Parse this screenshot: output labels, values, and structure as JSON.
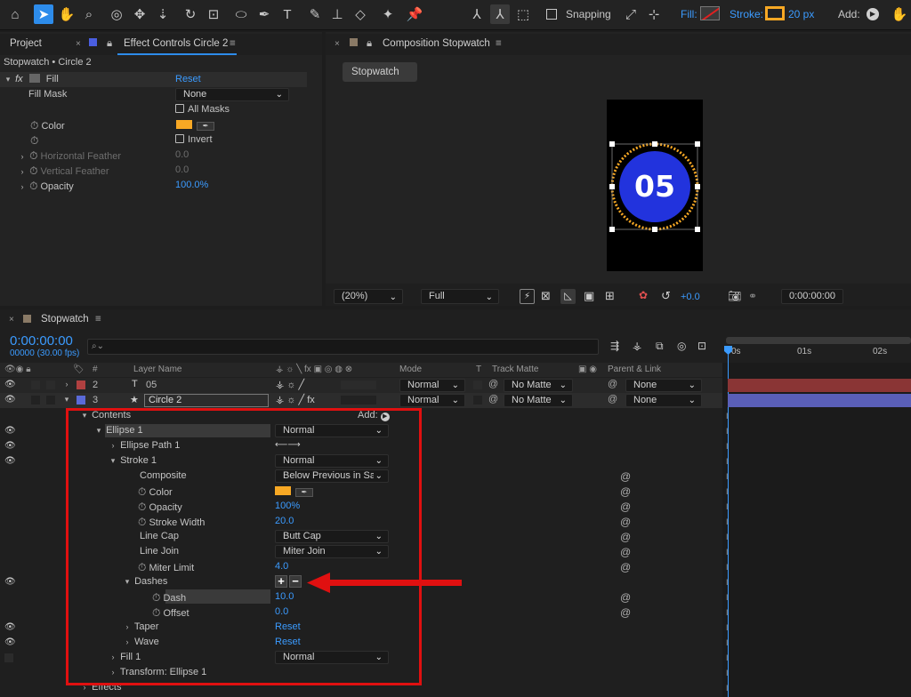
{
  "toolbar": {
    "snapping_label": "Snapping",
    "fill_label": "Fill:",
    "stroke_label": "Stroke:",
    "stroke_width": "20 px",
    "add_label": "Add:",
    "colors": {
      "stroke": "#f7a824"
    }
  },
  "effect_panel": {
    "tab_project": "Project",
    "tab_effect": "Effect Controls Circle 2",
    "breadcrumb": "Stopwatch • Circle 2",
    "effect_name": "Fill",
    "reset": "Reset",
    "fill_mask_label": "Fill Mask",
    "fill_mask_value": "None",
    "all_masks_label": "All Masks",
    "color_label": "Color",
    "invert_label": "Invert",
    "h_feather_label": "Horizontal Feather",
    "h_feather_value": "0.0",
    "v_feather_label": "Vertical Feather",
    "v_feather_value": "0.0",
    "opacity_label": "Opacity",
    "opacity_value": "100.0%"
  },
  "composition": {
    "tab": "Composition Stopwatch",
    "sub_tab": "Stopwatch",
    "display_number": "05",
    "zoom": "(20%)",
    "resolution": "Full",
    "exposure": "+0.0",
    "timecode": "0:00:00:00",
    "colors": {
      "circle": "#2233dd",
      "dots": "#f7a824"
    }
  },
  "timeline": {
    "tab": "Stopwatch",
    "current_time": "0:00:00:00",
    "fps": "00000 (30.00 fps)",
    "search_placeholder": "",
    "headers": {
      "hash": "#",
      "layer_name": "Layer Name",
      "mode": "Mode",
      "t": "T",
      "track_matte": "Track Matte",
      "parent": "Parent & Link"
    },
    "ruler": [
      "0s",
      "01s",
      "02s"
    ],
    "layers": [
      {
        "num": "2",
        "name": "05",
        "mode": "Normal",
        "matte": "No Matte",
        "parent": "None"
      },
      {
        "num": "3",
        "name": "Circle 2",
        "mode": "Normal",
        "matte": "No Matte",
        "parent": "None"
      }
    ],
    "props": {
      "contents": "Contents",
      "add": "Add:",
      "ellipse1": "Ellipse 1",
      "ellipse1_mode": "Normal",
      "ellipse_path": "Ellipse Path 1",
      "stroke1": "Stroke 1",
      "stroke1_mode": "Normal",
      "composite": "Composite",
      "composite_value": "Below Previous in Sa",
      "color": "Color",
      "opacity": "Opacity",
      "opacity_value": "100%",
      "stroke_width": "Stroke Width",
      "stroke_width_value": "20.0",
      "line_cap": "Line Cap",
      "line_cap_value": "Butt Cap",
      "line_join": "Line Join",
      "line_join_value": "Miter Join",
      "miter_limit": "Miter Limit",
      "miter_limit_value": "4.0",
      "dashes": "Dashes",
      "dash": "Dash",
      "dash_value": "10.0",
      "offset": "Offset",
      "offset_value": "0.0",
      "taper": "Taper",
      "taper_value": "Reset",
      "wave": "Wave",
      "wave_value": "Reset",
      "fill1": "Fill 1",
      "fill1_mode": "Normal",
      "transform": "Transform: Ellipse 1",
      "effects": "Effects"
    },
    "colors": {
      "layer2_bar": "#8a3535",
      "layer3_bar": "#5a5fb8",
      "highlight": "#e01010"
    }
  }
}
